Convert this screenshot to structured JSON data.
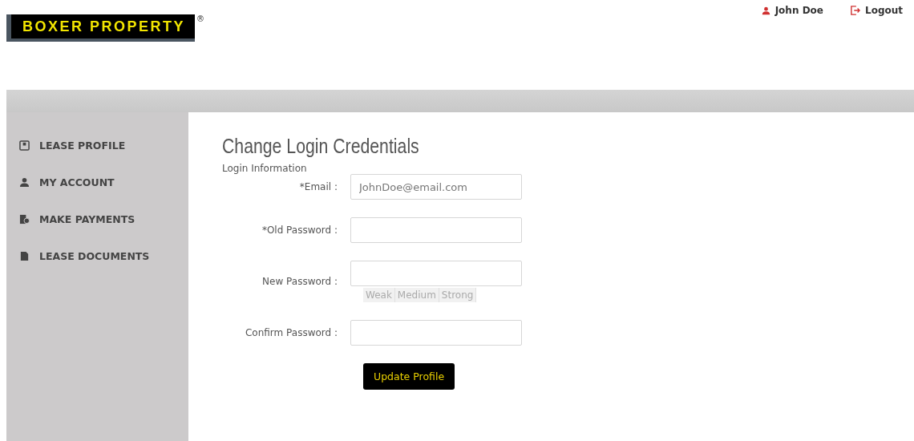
{
  "header": {
    "logo": "BOXER PROPERTY",
    "registered": "®",
    "user": "John Doe",
    "logout": "Logout"
  },
  "sidebar": {
    "items": [
      {
        "label": "LEASE PROFILE"
      },
      {
        "label": "MY ACCOUNT"
      },
      {
        "label": "MAKE PAYMENTS"
      },
      {
        "label": "LEASE DOCUMENTS"
      }
    ]
  },
  "form": {
    "title": "Change Login Credentials",
    "section": "Login Information",
    "fields": [
      {
        "label": "*Email :",
        "value": "JohnDoe@email.com"
      },
      {
        "label": "*Old Password :"
      },
      {
        "label": "New Password :",
        "strength": [
          "Weak",
          "Medium",
          "Strong"
        ]
      },
      {
        "label": "Confirm Password :"
      }
    ],
    "submit": "Update Profile"
  }
}
